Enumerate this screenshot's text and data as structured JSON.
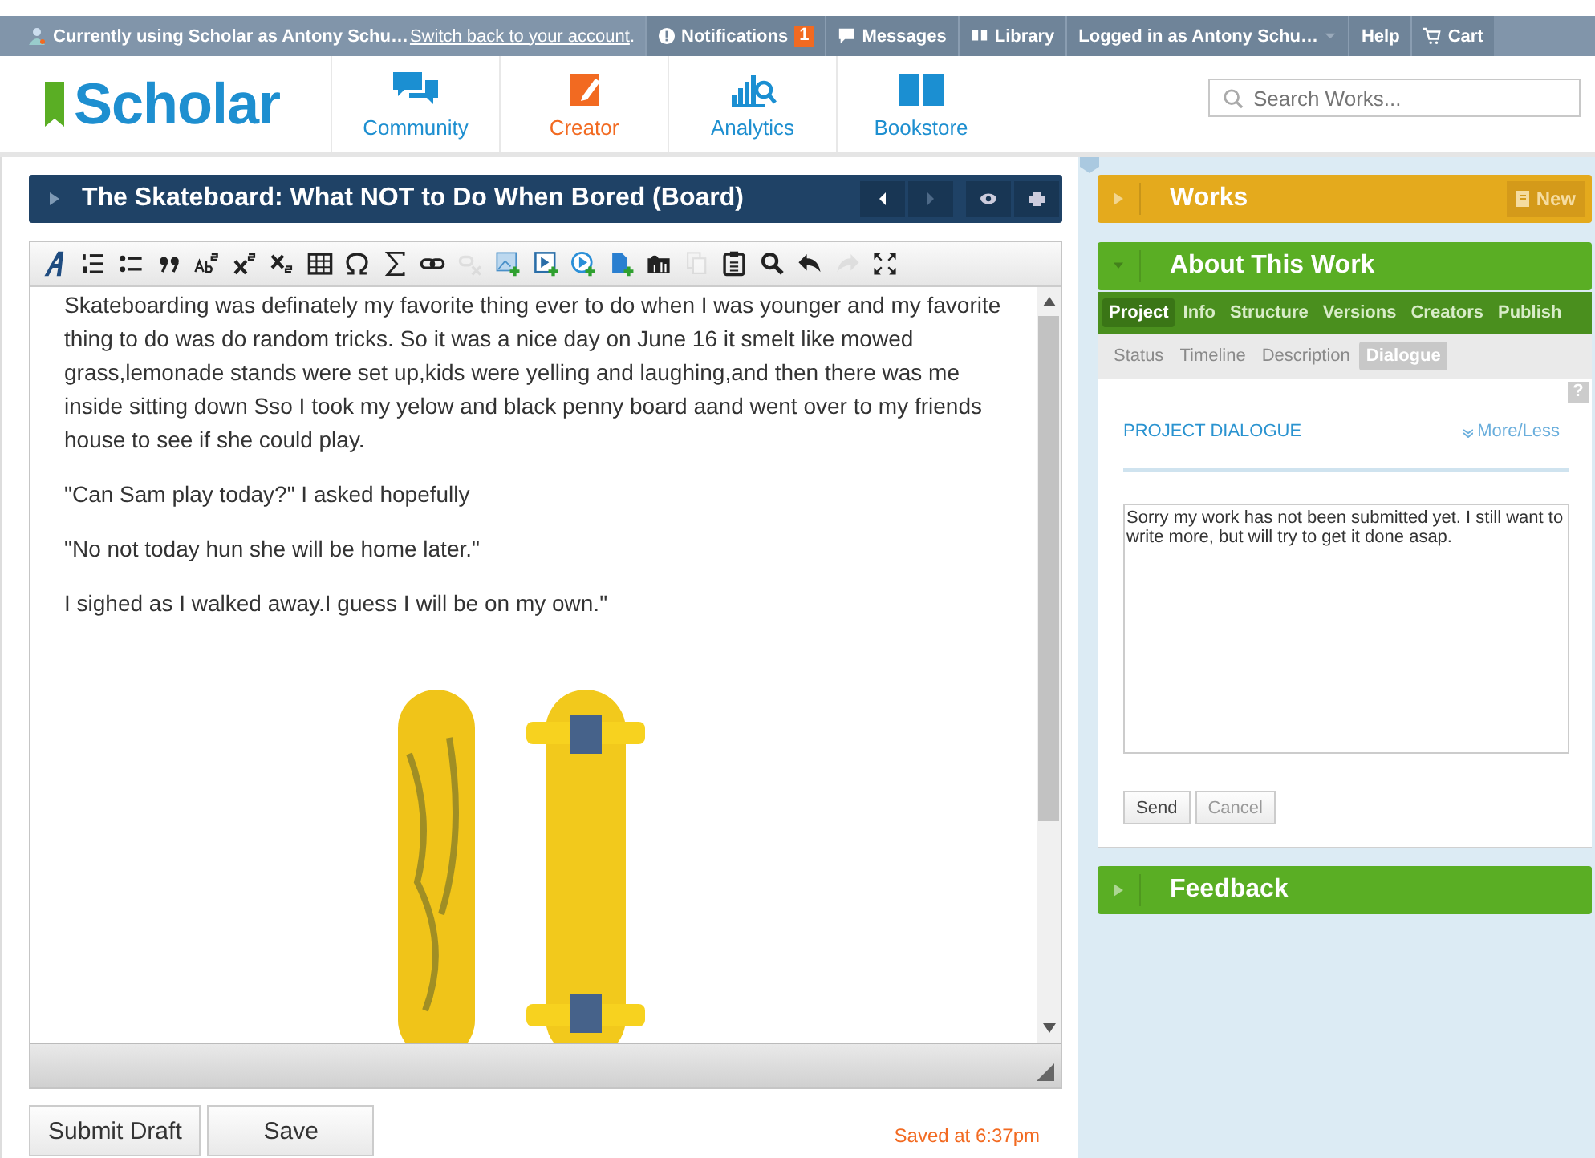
{
  "top_bar": {
    "user_notice": "Currently using Scholar as Antony Schu…",
    "switch_link": "Switch back to your account",
    "notice_end": ".",
    "items": [
      {
        "kind": "notifications",
        "label": "Notifications",
        "badge": "1"
      },
      {
        "kind": "messages",
        "label": "Messages"
      },
      {
        "kind": "library",
        "label": "Library"
      },
      {
        "kind": "account",
        "label": "Logged in as Antony Schu…"
      },
      {
        "kind": "help",
        "label": "Help"
      },
      {
        "kind": "cart",
        "label": "Cart"
      }
    ]
  },
  "header": {
    "logo": "Scholar",
    "nav": [
      {
        "kind": "community",
        "label": "Community",
        "selected": false
      },
      {
        "kind": "creator",
        "label": "Creator",
        "selected": true
      },
      {
        "kind": "analytics",
        "label": "Analytics",
        "selected": false
      },
      {
        "kind": "bookstore",
        "label": "Bookstore",
        "selected": false
      }
    ],
    "search": {
      "placeholder": "Search Works..."
    }
  },
  "document": {
    "title": "The Skateboard: What NOT to Do When Bored (Board)",
    "toolbar": [
      {
        "kind": "font",
        "disabled": false
      },
      {
        "kind": "ordered",
        "disabled": false
      },
      {
        "kind": "bullets",
        "disabled": false
      },
      {
        "kind": "quote",
        "disabled": false
      },
      {
        "kind": "caps",
        "disabled": false
      },
      {
        "kind": "sup",
        "disabled": false
      },
      {
        "kind": "sub",
        "disabled": false
      },
      {
        "kind": "table",
        "disabled": false
      },
      {
        "kind": "omega",
        "disabled": false
      },
      {
        "kind": "sigma",
        "disabled": false
      },
      {
        "kind": "link",
        "disabled": false
      },
      {
        "kind": "unlink",
        "disabled": true
      },
      {
        "kind": "image",
        "disabled": false
      },
      {
        "kind": "video",
        "disabled": false
      },
      {
        "kind": "play",
        "disabled": false
      },
      {
        "kind": "file",
        "disabled": false
      },
      {
        "kind": "audio",
        "disabled": false
      },
      {
        "kind": "copy",
        "disabled": true
      },
      {
        "kind": "paste",
        "disabled": false
      },
      {
        "kind": "search",
        "disabled": false
      },
      {
        "kind": "undo",
        "disabled": false
      },
      {
        "kind": "redo",
        "disabled": true
      },
      {
        "kind": "fullscreen",
        "disabled": false
      }
    ],
    "paragraphs": [
      "Skateboarding was definately my favorite thing ever to do when I was younger and my favorite thing to do was do random tricks. So it was a nice day on June 16 it smelt like mowed grass,lemonade stands were set up,kids were yelling and laughing,and then there was me inside sitting down Sso I took my yelow and black penny board aand went over to my friends house to see if she could play.",
      "\"Can Sam play today?\" I asked hopefully",
      "\"No not today hun she will be home later.\"",
      "I sighed as I walked away.I guess I will be on my own.\""
    ],
    "buttons": [
      {
        "label": "Submit Draft"
      },
      {
        "label": "Save"
      }
    ],
    "saved_note": "Saved at 6:37pm"
  },
  "side": {
    "works": {
      "title": "Works",
      "new_button": "New",
      "expanded": false
    },
    "about": {
      "title": "About This Work",
      "expanded": true,
      "tabs": [
        {
          "label": "Project",
          "selected": true
        },
        {
          "label": "Info",
          "selected": false
        },
        {
          "label": "Structure",
          "selected": false
        },
        {
          "label": "Versions",
          "selected": false
        },
        {
          "label": "Creators",
          "selected": false
        },
        {
          "label": "Publish",
          "selected": false
        }
      ],
      "subtabs": [
        {
          "label": "Status",
          "selected": false
        },
        {
          "label": "Timeline",
          "selected": false
        },
        {
          "label": "Description",
          "selected": false
        },
        {
          "label": "Dialogue",
          "selected": true
        }
      ],
      "help": "?",
      "section_label": "PROJECT DIALOGUE",
      "more_less": "More/Less",
      "message": "Sorry my work has not been submitted yet. I still want to write more, but will try to get it done asap.",
      "buttons": [
        {
          "label": "Send",
          "disabled": false
        },
        {
          "label": "Cancel",
          "disabled": true
        }
      ]
    },
    "feedback": {
      "title": "Feedback",
      "expanded": false
    }
  }
}
